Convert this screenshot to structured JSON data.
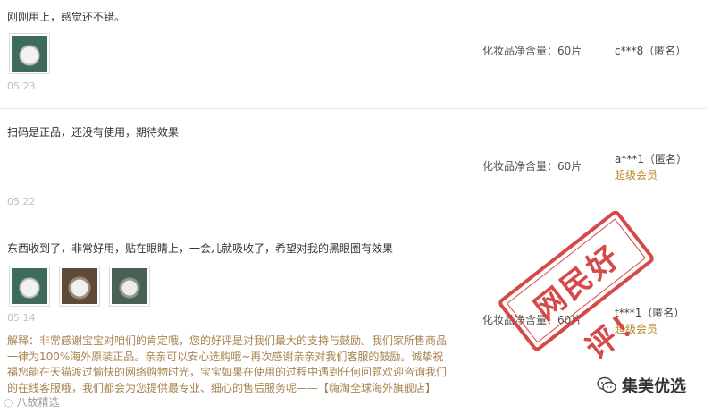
{
  "reviews": [
    {
      "text": "刚刚用上，感觉还不错。",
      "date": "05.23",
      "sku": "化妆品净含量：60片",
      "user": "c***8（匿名）",
      "badge": "",
      "photos": [
        "review-photo"
      ]
    },
    {
      "text": "扫码是正品，还没有使用，期待效果",
      "date": "05.22",
      "sku": "化妆品净含量：60片",
      "user": "a***1（匿名）",
      "badge": "超级会员",
      "photos": []
    },
    {
      "text": "东西收到了，非常好用，贴在眼睛上，一会儿就吸收了，希望对我的黑眼圈有效果",
      "date": "05.14",
      "sku": "化妆品净含量：60片",
      "user": "t***1（匿名）",
      "badge": "超级会员",
      "photos": [
        "review-photo",
        "review-photo",
        "review-photo"
      ],
      "reply": "解释：非常感谢宝宝对咱们的肯定哦，您的好评是对我们最大的支持与鼓励。我们家所售商品一律为100%海外原装正品。亲亲可以安心选购哦~再次感谢亲亲对我们客服的鼓励。诚挚祝福您能在天猫渡过愉快的网络购物时光，宝宝如果在使用的过程中遇到任何问题欢迎咨询我们的在线客服哦，我们都会为您提供最专业、细心的售后服务呢——【嗨淘全球海外旗舰店】"
    }
  ],
  "stamp": "网民好评！",
  "watermark_left": "八故精选",
  "watermark_right": "集美优选",
  "colors": {
    "stamp": "#d23a3a",
    "reply": "#a8834e",
    "badge": "#b78a2a"
  }
}
